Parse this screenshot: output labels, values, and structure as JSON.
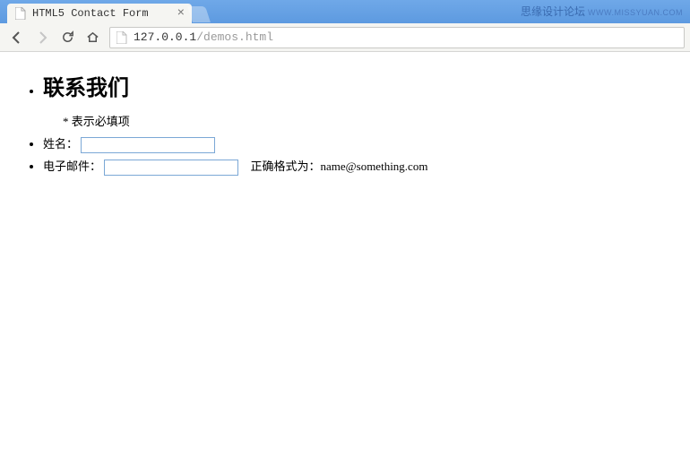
{
  "browser": {
    "tab_title": "HTML5 Contact Form",
    "omnibox_host": "127.0.0.1",
    "omnibox_path": "/demos.html"
  },
  "watermark": {
    "text": "思缘设计论坛",
    "url": "WWW.MISSYUAN.COM"
  },
  "form": {
    "heading": "联系我们",
    "required_note": "* 表示必填项",
    "fields": {
      "name": {
        "label": "姓名：",
        "value": ""
      },
      "email": {
        "label": "电子邮件：",
        "value": "",
        "hint": "正确格式为：name@something.com"
      }
    }
  }
}
